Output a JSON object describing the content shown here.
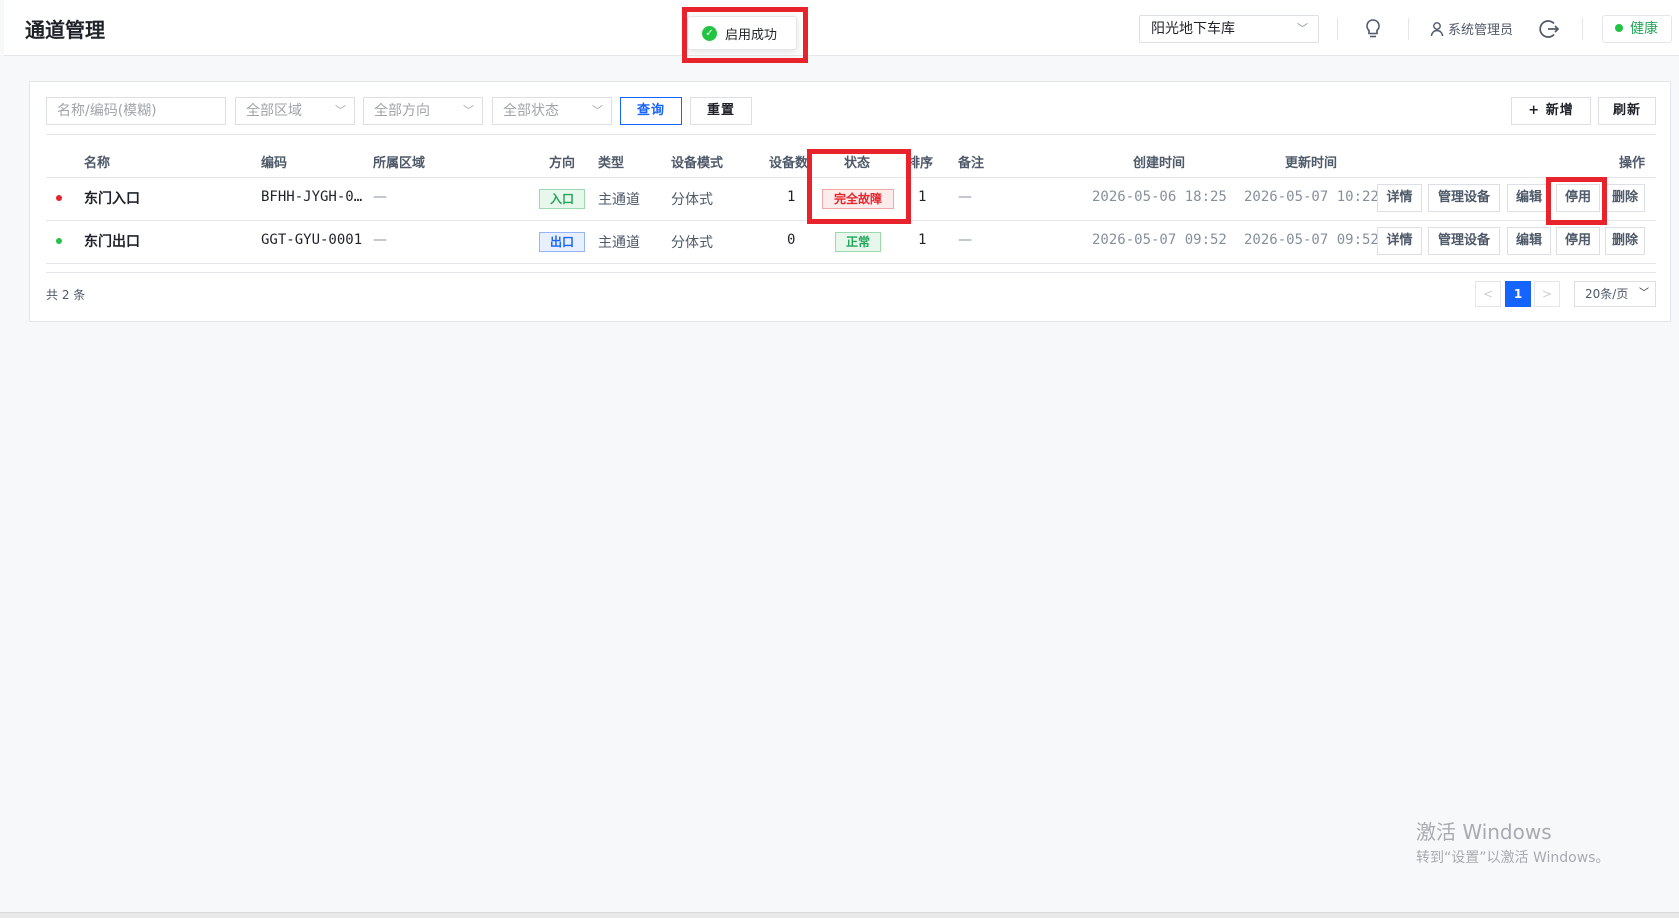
{
  "page": {
    "title": "通道管理"
  },
  "toast": {
    "message": "启用成功",
    "icon": "check-circle-icon"
  },
  "topbar": {
    "garage": "阳光地下车库",
    "user": "系统管理员",
    "health": "健康"
  },
  "filters": {
    "search_placeholder": "名称/编码(模糊)",
    "area": "全部区域",
    "direction": "全部方向",
    "status": "全部状态",
    "query_label": "查询",
    "reset_label": "重置",
    "add_label": "+ 新增",
    "refresh_label": "刷新"
  },
  "table": {
    "headers": {
      "name": "名称",
      "code": "编码",
      "area": "所属区域",
      "direction": "方向",
      "type": "类型",
      "mode": "设备模式",
      "device_count": "设备数",
      "status": "状态",
      "sort": "排序",
      "remark": "备注",
      "created": "创建时间",
      "updated": "更新时间",
      "actions": "操作"
    },
    "rows": [
      {
        "name": "东门入口",
        "code": "BFHH-JYGH-0…",
        "area": "—",
        "direction": "入口",
        "type": "主通道",
        "mode": "分体式",
        "device_count": "1",
        "status": "完全故障",
        "sort": "1",
        "remark": "—",
        "created": "2026-05-06 18:25",
        "updated": "2026-05-07 10:22",
        "actions": {
          "detail": "详情",
          "manage": "管理设备",
          "edit": "编辑",
          "toggle": "停用",
          "delete": "删除"
        }
      },
      {
        "name": "东门出口",
        "code": "GGT-GYU-0001",
        "area": "—",
        "direction": "出口",
        "type": "主通道",
        "mode": "分体式",
        "device_count": "0",
        "status": "正常",
        "sort": "1",
        "remark": "—",
        "created": "2026-05-07 09:52",
        "updated": "2026-05-07 09:52",
        "actions": {
          "detail": "详情",
          "manage": "管理设备",
          "edit": "编辑",
          "toggle": "停用",
          "delete": "删除"
        }
      }
    ]
  },
  "pagination": {
    "total": "共 2 条",
    "prev": "<",
    "current": "1",
    "next": ">",
    "page_size": "20条/页"
  },
  "watermark": {
    "line1": "激活 Windows",
    "line2": "转到“设置”以激活 Windows。"
  },
  "colors": {
    "primary": "#1664ff",
    "success": "#23c343",
    "danger": "#e8232b",
    "highlight_box": "#e8232b"
  }
}
